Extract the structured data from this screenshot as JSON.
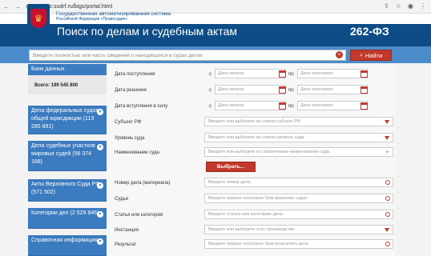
{
  "browser": {
    "url": "bsr.sudrf.ru/bigs/portal.html"
  },
  "header": {
    "org_line1": "Государственная автоматизированная система",
    "org_line2": "Российской Федерации «Правосудие»",
    "title": "Поиск по делам и судебным актам",
    "law": "262-ФЗ"
  },
  "search": {
    "placeholder": "Введите полностью или часть сведений о находящихся в судах делах",
    "button_label": "Найти"
  },
  "sidebar": {
    "db_title": "Банк данных",
    "db_total": "Всего: 199 545 800",
    "items": [
      {
        "label": "Дела федеральных судов общей юрисдикции (113 285 891)"
      },
      {
        "label": "Дела судебных участков мировых судей (56 374 168)"
      },
      {
        "label": "Акты Верховного Суда РФ (571 502)"
      },
      {
        "label": "Категории дел (2 529 846)"
      },
      {
        "label": "Справочная информация"
      }
    ]
  },
  "form": {
    "date_from_prefix": "с",
    "date_to_prefix": "по",
    "date_from_placeholder": "Дата начала",
    "date_to_placeholder": "Дата окончания",
    "labels": {
      "receipt_date": "Дата поступления",
      "decision_date": "Дата решения",
      "effective_date": "Дата вступления в силу",
      "subject": "Субъект РФ",
      "court_level": "Уровень суда",
      "court_name": "Наименование суда",
      "case_number": "Номер дела (материала)",
      "judge": "Судья",
      "article": "Статья или категория",
      "instance": "Инстанция",
      "result": "Результат"
    },
    "placeholders": {
      "subject": "Введите или выберите из списка субъект РФ",
      "court_level": "Введите или выберите из списка уровень суда",
      "court_name": "Введите или выберите из справочника наименования суда",
      "case_number": "Введите номер дела",
      "judge": "Введите первые несколько букв фамилии судьи",
      "article": "Введите статью или категорию дела",
      "instance": "Введите или выберите этап производства",
      "result": "Введите первые несколько букв результата дела"
    },
    "choose_button": "Выбрать..."
  },
  "colors": {
    "header_bg": "#0d4c86",
    "search_bar_bg": "#4a8ccb",
    "sidebar_bg": "#3b7bbf",
    "accent_red": "#c0392b"
  }
}
